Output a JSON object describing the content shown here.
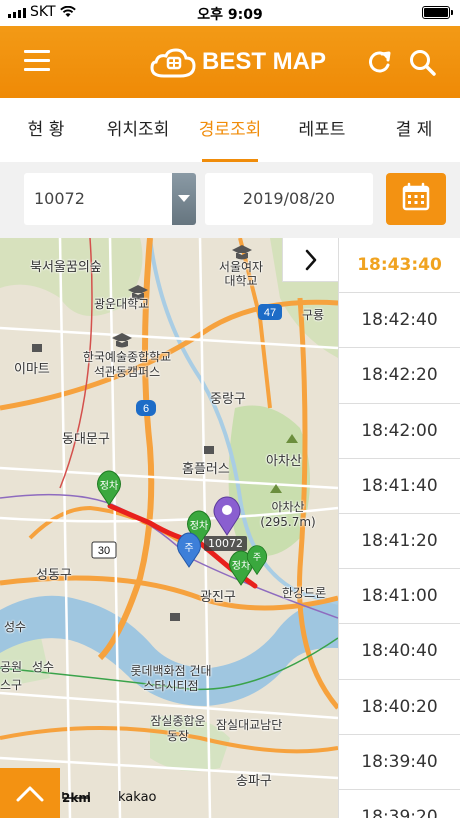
{
  "status_bar": {
    "carrier": "SKT",
    "time": "오후 9:09"
  },
  "header": {
    "title": "BEST MAP",
    "brand_color": "#f08c0a",
    "menu_icon": "hamburger-icon",
    "refresh_icon": "refresh-icon",
    "search_icon": "search-icon"
  },
  "tabs": [
    {
      "label": "현 황",
      "active": false
    },
    {
      "label": "위치조회",
      "active": false
    },
    {
      "label": "경로조회",
      "active": true
    },
    {
      "label": "레포트",
      "active": false
    },
    {
      "label": "결 제",
      "active": false
    }
  ],
  "filter": {
    "vehicle": "10072",
    "date": "2019/08/20",
    "calendar_icon": "calendar-icon"
  },
  "map": {
    "labels": [
      "북서울꿈의숲",
      "서울여자대학교",
      "광운대학교",
      "한국예술종합학교 석관동캠퍼스",
      "이마트",
      "중랑구",
      "동대문구",
      "홈플러스",
      "아차산",
      "아차산 (295.7m)",
      "성동구",
      "광진구",
      "성수",
      "롯데백화점 건대스타시티점",
      "잠실종합운동장",
      "잠실대교남단",
      "송파구",
      "한강드론",
      "구룡",
      "공원",
      "스구"
    ],
    "road_numbers": [
      "47",
      "6",
      "30"
    ],
    "markers": [
      "정차",
      "정차",
      "주",
      "정차",
      "주"
    ],
    "vehicle_label": "10072",
    "scale": "2km",
    "provider": "kakao"
  },
  "times": [
    "18:43:40",
    "18:42:40",
    "18:42:20",
    "18:42:00",
    "18:41:40",
    "18:41:20",
    "18:41:00",
    "18:40:40",
    "18:40:20",
    "18:39:40",
    "18:39:20"
  ],
  "active_time_index": 0
}
